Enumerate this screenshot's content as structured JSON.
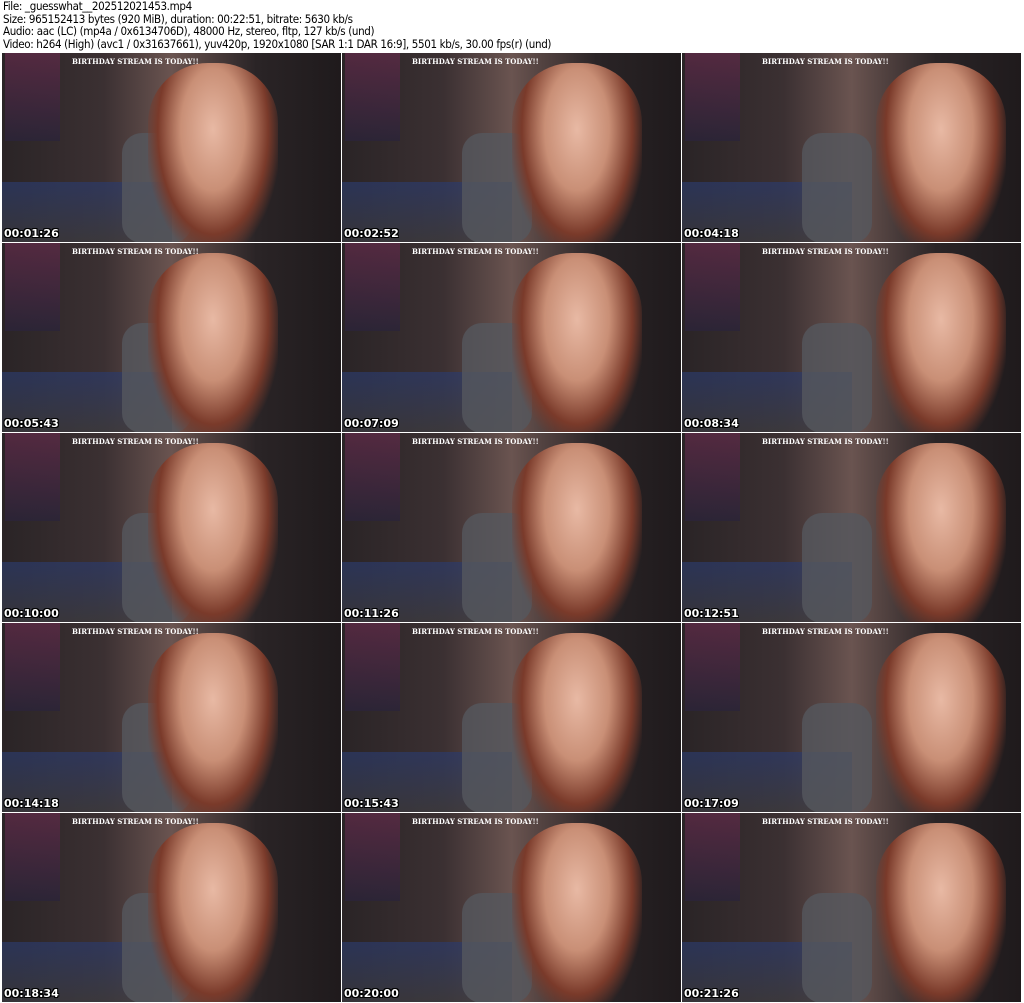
{
  "header": {
    "file": "File: _guesswhat__202512021453.mp4",
    "size": "Size: 965152413 bytes (920 MiB), duration: 00:22:51, bitrate: 5630 kb/s",
    "audio": "Audio: aac (LC) (mp4a / 0x6134706D), 48000 Hz, stereo, fltp, 127 kb/s (und)",
    "video": "Video: h264 (High) (avc1 / 0x31637661), yuv420p, 1920x1080 [SAR 1:1 DAR 16:9], 5501 kb/s, 30.00 fps(r) (und)"
  },
  "overlay_banner": "BIRTHDAY STREAM IS TODAY!!",
  "thumbnails": [
    {
      "timestamp": "00:01:26"
    },
    {
      "timestamp": "00:02:52"
    },
    {
      "timestamp": "00:04:18"
    },
    {
      "timestamp": "00:05:43"
    },
    {
      "timestamp": "00:07:09"
    },
    {
      "timestamp": "00:08:34"
    },
    {
      "timestamp": "00:10:00"
    },
    {
      "timestamp": "00:11:26"
    },
    {
      "timestamp": "00:12:51"
    },
    {
      "timestamp": "00:14:18"
    },
    {
      "timestamp": "00:15:43"
    },
    {
      "timestamp": "00:17:09"
    },
    {
      "timestamp": "00:18:34"
    },
    {
      "timestamp": "00:20:00"
    },
    {
      "timestamp": "00:21:26"
    }
  ]
}
